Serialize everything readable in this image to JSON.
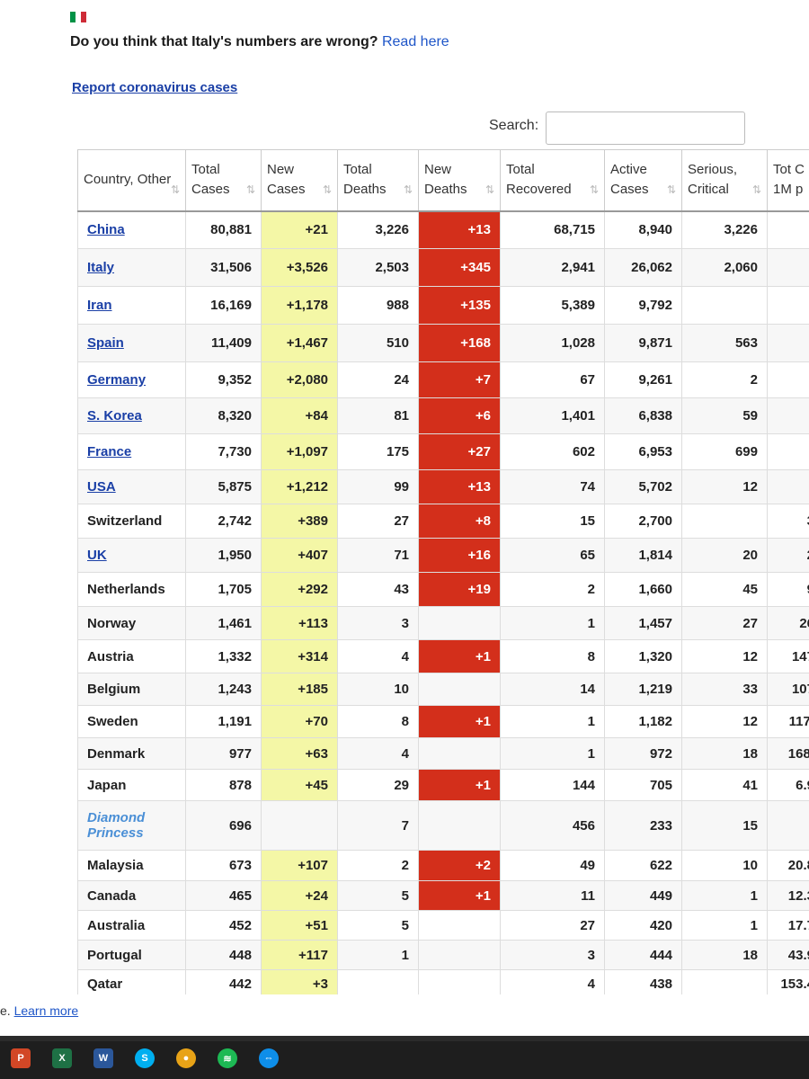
{
  "header": {
    "question": "Do you think that Italy's numbers are wrong?",
    "read_here": "Read here",
    "report_link": "Report coronavirus cases",
    "search_label": "Search:"
  },
  "table": {
    "columns": [
      {
        "label": "Country, Other"
      },
      {
        "label": "Total Cases"
      },
      {
        "label": "New Cases"
      },
      {
        "label": "Total Deaths"
      },
      {
        "label": "New Deaths"
      },
      {
        "label": "Total Recovered"
      },
      {
        "label": "Active Cases"
      },
      {
        "label": "Serious, Critical"
      },
      {
        "label": "Tot C 1M p"
      }
    ],
    "rows": [
      {
        "country": "China",
        "linked": true,
        "total": "80,881",
        "new": "+21",
        "deaths": "3,226",
        "new_deaths": "+13",
        "recovered": "68,715",
        "active": "8,940",
        "serious": "3,226",
        "per_million": ""
      },
      {
        "country": "Italy",
        "linked": true,
        "total": "31,506",
        "new": "+3,526",
        "deaths": "2,503",
        "new_deaths": "+345",
        "recovered": "2,941",
        "active": "26,062",
        "serious": "2,060",
        "per_million": ""
      },
      {
        "country": "Iran",
        "linked": true,
        "total": "16,169",
        "new": "+1,178",
        "deaths": "988",
        "new_deaths": "+135",
        "recovered": "5,389",
        "active": "9,792",
        "serious": "",
        "per_million": ""
      },
      {
        "country": "Spain",
        "linked": true,
        "total": "11,409",
        "new": "+1,467",
        "deaths": "510",
        "new_deaths": "+168",
        "recovered": "1,028",
        "active": "9,871",
        "serious": "563",
        "per_million": ""
      },
      {
        "country": "Germany",
        "linked": true,
        "total": "9,352",
        "new": "+2,080",
        "deaths": "24",
        "new_deaths": "+7",
        "recovered": "67",
        "active": "9,261",
        "serious": "2",
        "per_million": ""
      },
      {
        "country": "S. Korea",
        "linked": true,
        "total": "8,320",
        "new": "+84",
        "deaths": "81",
        "new_deaths": "+6",
        "recovered": "1,401",
        "active": "6,838",
        "serious": "59",
        "per_million": ""
      },
      {
        "country": "France",
        "linked": true,
        "total": "7,730",
        "new": "+1,097",
        "deaths": "175",
        "new_deaths": "+27",
        "recovered": "602",
        "active": "6,953",
        "serious": "699",
        "per_million": ""
      },
      {
        "country": "USA",
        "linked": true,
        "total": "5,875",
        "new": "+1,212",
        "deaths": "99",
        "new_deaths": "+13",
        "recovered": "74",
        "active": "5,702",
        "serious": "12",
        "per_million": ""
      },
      {
        "country": "Switzerland",
        "linked": false,
        "total": "2,742",
        "new": "+389",
        "deaths": "27",
        "new_deaths": "+8",
        "recovered": "15",
        "active": "2,700",
        "serious": "",
        "per_million": "3"
      },
      {
        "country": "UK",
        "linked": true,
        "total": "1,950",
        "new": "+407",
        "deaths": "71",
        "new_deaths": "+16",
        "recovered": "65",
        "active": "1,814",
        "serious": "20",
        "per_million": "2"
      },
      {
        "country": "Netherlands",
        "linked": false,
        "total": "1,705",
        "new": "+292",
        "deaths": "43",
        "new_deaths": "+19",
        "recovered": "2",
        "active": "1,660",
        "serious": "45",
        "per_million": "9"
      },
      {
        "country": "Norway",
        "linked": false,
        "total": "1,461",
        "new": "+113",
        "deaths": "3",
        "new_deaths": "",
        "recovered": "1",
        "active": "1,457",
        "serious": "27",
        "per_million": "26"
      },
      {
        "country": "Austria",
        "linked": false,
        "total": "1,332",
        "new": "+314",
        "deaths": "4",
        "new_deaths": "+1",
        "recovered": "8",
        "active": "1,320",
        "serious": "12",
        "per_million": "147"
      },
      {
        "country": "Belgium",
        "linked": false,
        "total": "1,243",
        "new": "+185",
        "deaths": "10",
        "new_deaths": "",
        "recovered": "14",
        "active": "1,219",
        "serious": "33",
        "per_million": "107"
      },
      {
        "country": "Sweden",
        "linked": false,
        "total": "1,191",
        "new": "+70",
        "deaths": "8",
        "new_deaths": "+1",
        "recovered": "1",
        "active": "1,182",
        "serious": "12",
        "per_million": "117."
      },
      {
        "country": "Denmark",
        "linked": false,
        "total": "977",
        "new": "+63",
        "deaths": "4",
        "new_deaths": "",
        "recovered": "1",
        "active": "972",
        "serious": "18",
        "per_million": "168."
      },
      {
        "country": "Japan",
        "linked": false,
        "total": "878",
        "new": "+45",
        "deaths": "29",
        "new_deaths": "+1",
        "recovered": "144",
        "active": "705",
        "serious": "41",
        "per_million": "6.9"
      },
      {
        "country": "Diamond Princess",
        "linked": false,
        "ship": true,
        "total": "696",
        "new": "",
        "deaths": "7",
        "new_deaths": "",
        "recovered": "456",
        "active": "233",
        "serious": "15",
        "per_million": ""
      },
      {
        "country": "Malaysia",
        "linked": false,
        "total": "673",
        "new": "+107",
        "deaths": "2",
        "new_deaths": "+2",
        "recovered": "49",
        "active": "622",
        "serious": "10",
        "per_million": "20.8"
      },
      {
        "country": "Canada",
        "linked": false,
        "total": "465",
        "new": "+24",
        "deaths": "5",
        "new_deaths": "+1",
        "recovered": "11",
        "active": "449",
        "serious": "1",
        "per_million": "12.3"
      },
      {
        "country": "Australia",
        "linked": false,
        "total": "452",
        "new": "+51",
        "deaths": "5",
        "new_deaths": "",
        "recovered": "27",
        "active": "420",
        "serious": "1",
        "per_million": "17.7"
      },
      {
        "country": "Portugal",
        "linked": false,
        "total": "448",
        "new": "+117",
        "deaths": "1",
        "new_deaths": "",
        "recovered": "3",
        "active": "444",
        "serious": "18",
        "per_million": "43.9"
      },
      {
        "country": "Qatar",
        "linked": false,
        "total": "442",
        "new": "+3",
        "deaths": "",
        "new_deaths": "",
        "recovered": "4",
        "active": "438",
        "serious": "",
        "per_million": "153.4"
      }
    ]
  },
  "footer": {
    "learn_prefix": "e.",
    "learn_more": "Learn more"
  },
  "taskbar": {
    "icons": [
      {
        "name": "powerpoint-icon",
        "glyph": "P",
        "color": "#d24726"
      },
      {
        "name": "excel-icon",
        "glyph": "X",
        "color": "#1e7145"
      },
      {
        "name": "word-icon",
        "glyph": "W",
        "color": "#2b579a"
      },
      {
        "name": "skype-icon",
        "glyph": "S",
        "color": "#00aff0"
      },
      {
        "name": "chrome-icon",
        "glyph": "●",
        "color": "#e8a317"
      },
      {
        "name": "spotify-icon",
        "glyph": "≋",
        "color": "#1db954"
      },
      {
        "name": "teamviewer-icon",
        "glyph": "⇔",
        "color": "#0e8ee9"
      }
    ]
  },
  "colors": {
    "new_cases_highlight": "#f4f7a6",
    "new_deaths_highlight": "#d32f1b",
    "link": "#1a3fa6"
  }
}
